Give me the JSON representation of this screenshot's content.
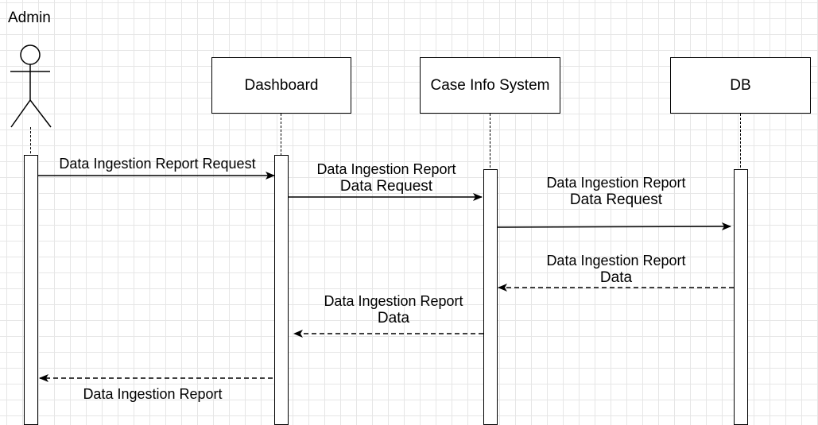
{
  "actor": {
    "name": "Admin"
  },
  "participants": [
    {
      "id": "dashboard",
      "label": "Dashboard"
    },
    {
      "id": "cis",
      "label": "Case Info System"
    },
    {
      "id": "db",
      "label": "DB"
    }
  ],
  "messages": [
    {
      "id": "m1",
      "line1": "Data Ingestion Report Request",
      "line2": "",
      "style": "solid"
    },
    {
      "id": "m2",
      "line1": "Data Ingestion Report",
      "line2": "Data Request",
      "style": "solid"
    },
    {
      "id": "m3",
      "line1": "Data Ingestion Report",
      "line2": "Data Request",
      "style": "solid"
    },
    {
      "id": "m4",
      "line1": "Data Ingestion Report",
      "line2": "Data",
      "style": "dashed"
    },
    {
      "id": "m5",
      "line1": "Data Ingestion Report",
      "line2": "Data",
      "style": "dashed"
    },
    {
      "id": "m6",
      "line1": "Data Ingestion Report",
      "line2": "",
      "style": "dashed"
    }
  ]
}
